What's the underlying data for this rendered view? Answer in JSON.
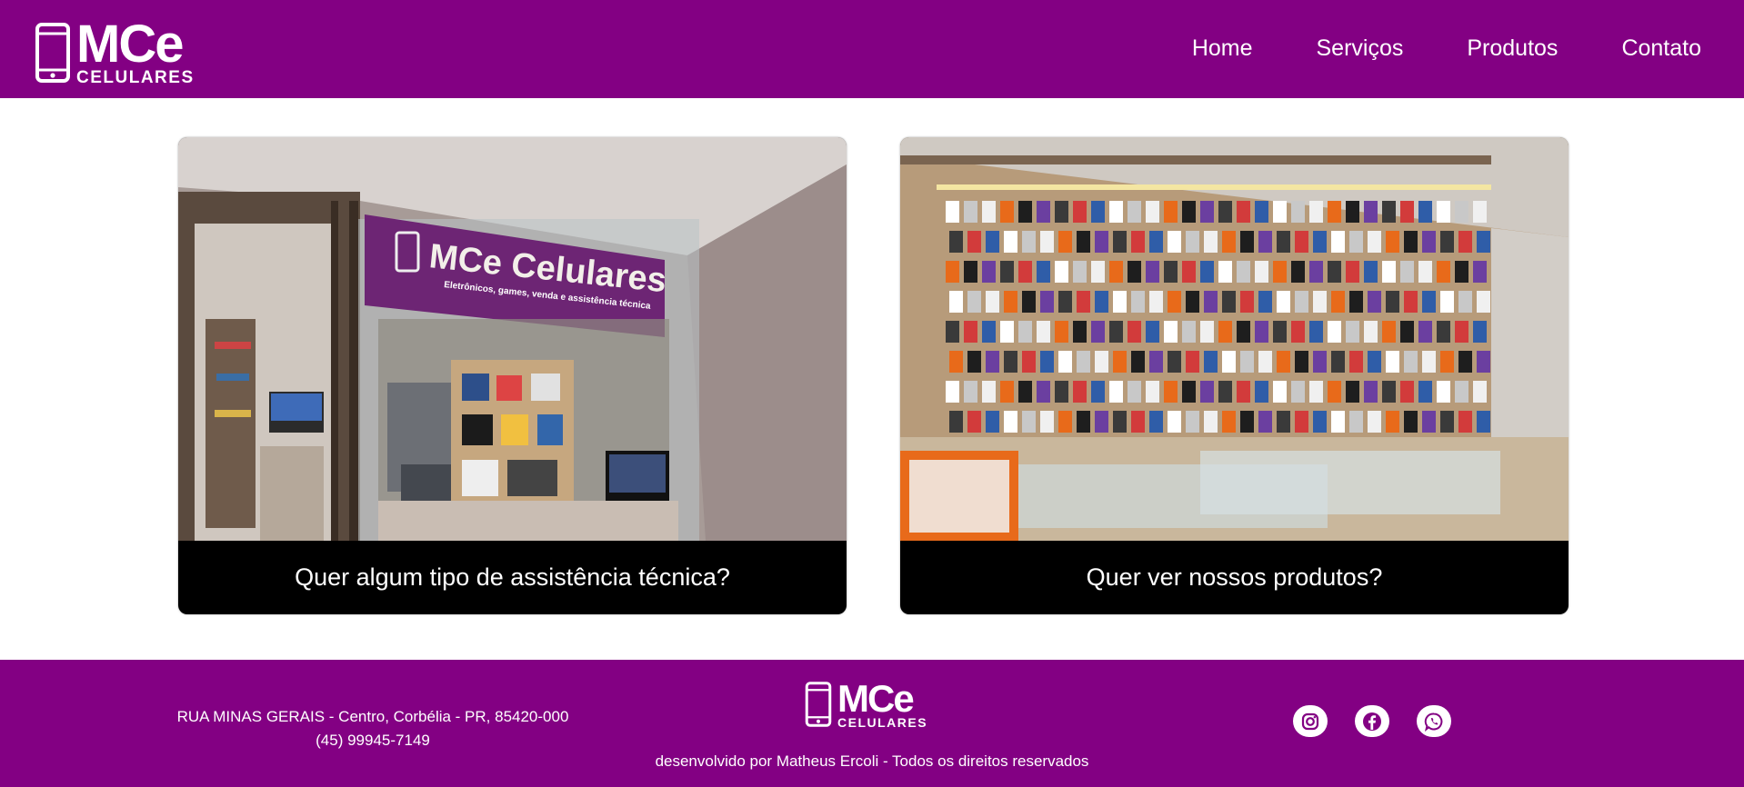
{
  "brand": {
    "name": "MCe",
    "subtitle": "CELULARES",
    "color": "#830083"
  },
  "nav": {
    "items": [
      "Home",
      "Serviços",
      "Produtos",
      "Contato"
    ]
  },
  "cards": [
    {
      "caption": "Quer algum tipo de assistência técnica?",
      "sign_title": "MCe Celulares",
      "sign_tagline": "Eletrônicos, games, venda e assistência técnica",
      "image": "storefront-photo"
    },
    {
      "caption": "Quer ver nossos produtos?",
      "image": "products-wall-photo"
    }
  ],
  "footer": {
    "address_line1": "RUA MINAS GERAIS - Centro, Corbélia - PR, 85420-000",
    "phone": "(45) 99945-7149",
    "credit": "desenvolvido por Matheus Ercoli - Todos os direitos reservados",
    "social": [
      "instagram-icon",
      "facebook-icon",
      "whatsapp-icon"
    ]
  }
}
